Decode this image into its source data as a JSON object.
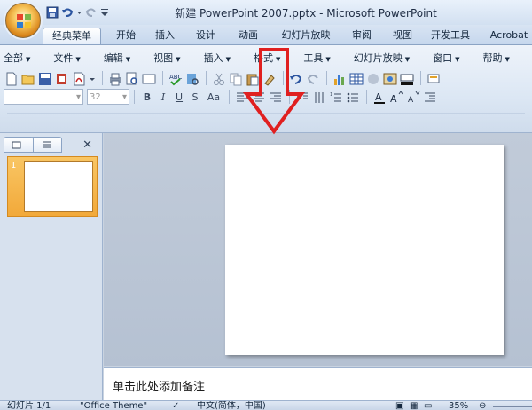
{
  "window": {
    "title": "新建 PowerPoint 2007.pptx - Microsoft PowerPoint"
  },
  "ribbon_tabs": [
    {
      "label": "经典菜单",
      "active": true
    },
    {
      "label": "开始"
    },
    {
      "label": "插入"
    },
    {
      "label": "设计"
    },
    {
      "label": "动画"
    },
    {
      "label": "幻灯片放映"
    },
    {
      "label": "审阅"
    },
    {
      "label": "视图"
    },
    {
      "label": "开发工具"
    },
    {
      "label": "Acrobat"
    }
  ],
  "classic_menu": {
    "items": [
      "全部",
      "文件",
      "编辑",
      "视图",
      "插入",
      "格式",
      "工具",
      "幻灯片放映",
      "窗口",
      "帮助"
    ]
  },
  "format_toolbar": {
    "font_size": "32",
    "font_name": "",
    "buttons": [
      "B",
      "I",
      "U",
      "S",
      "Aa"
    ]
  },
  "slides_panel": {
    "slide_number": "1",
    "close_label": "✕"
  },
  "notes": {
    "placeholder": "单击此处添加备注"
  },
  "status": {
    "slide_info": "幻灯片 1/1",
    "theme": "\"Office Theme\"",
    "language": "中文(简体，中国)",
    "zoom": "35%"
  },
  "colors": {
    "annotation_arrow": "#e02020",
    "thumbnail_highlight": "#f2a93a",
    "ribbon_bg": "#dce7f4"
  },
  "icons": [
    "office-button-icon",
    "save-icon",
    "undo-icon",
    "redo-icon",
    "new-icon",
    "open-icon",
    "print-icon",
    "paste-icon",
    "chart-icon",
    "table-icon",
    "close-icon"
  ]
}
